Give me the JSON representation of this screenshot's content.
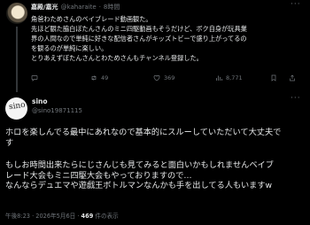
{
  "parent_post": {
    "display_name": "嘉殿/嘉光",
    "handle": "@kaharaite",
    "timestamp": "8時間",
    "lines": [
      "角爸わためさんのベイブレード動画観た。",
      "先ほど観た脇白ぼたんさんのミニ四駆動画もそうだけど、ボク自身が玩具業",
      "界の人間なので単純に好きな配信者さんがキッズトビーで盛り上がってるの",
      "を観るのが単純に楽しい。",
      "とりあえずぼたんさんとわためさんもチャンネル登録した。"
    ],
    "actions": {
      "replies": "",
      "reposts": "49",
      "likes": "369",
      "views": "8,771"
    }
  },
  "reply_post": {
    "display_name": "sino",
    "handle": "@sino19871115",
    "avatar_text": "sino",
    "paragraphs": [
      [
        "ホロを楽しんでる最中にあれなので基本的にスルーしていただいて大丈夫で",
        "す"
      ],
      [
        "もしお時間出来たらにじさんじも見てみると面白いかもしれませんベイブ",
        "レード大会もミニ四駆大会もやっておりますので…",
        "なんならデュエマや遊戯王ボトルマンなんかも手を出してる人もいますw"
      ]
    ],
    "meta_time": "午後8:23 · 2026年5月6日 · ",
    "meta_views_count": "469",
    "meta_views_label": " 件の表示"
  }
}
